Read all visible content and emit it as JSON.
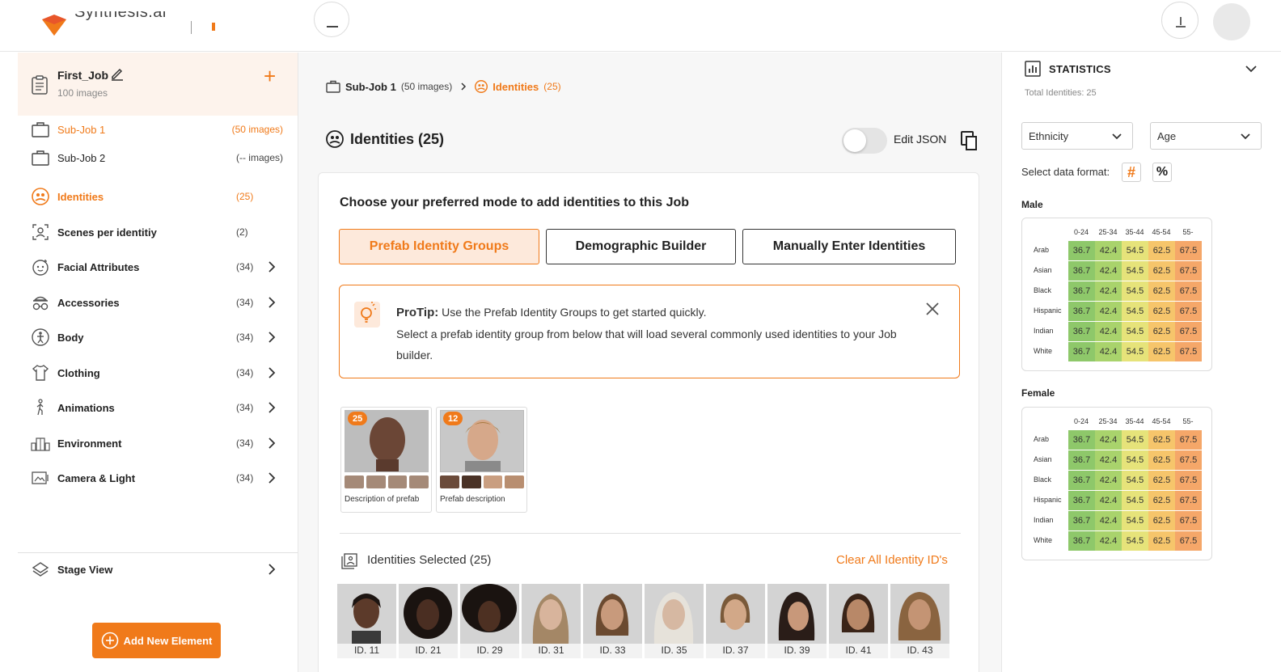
{
  "app": {
    "brand_text": "Synthesis.ai",
    "colors": {
      "accent": "#f07a1a",
      "accent_light": "#fde9db"
    }
  },
  "sidebar": {
    "job_title": "First_Job",
    "job_subtitle": "100 images",
    "items": [
      {
        "label": "Sub-Job 1",
        "count": "(50 images)",
        "icon": "briefcase-icon",
        "active": true
      },
      {
        "label": "Sub-Job 2",
        "count": "(-- images)",
        "icon": "briefcase-icon",
        "active": false
      },
      {
        "label": "Identities",
        "count": "(25)",
        "icon": "identities-icon",
        "active": true
      },
      {
        "label": "Scenes per identitiy",
        "count": "(2)",
        "icon": "scenes-icon",
        "active": false
      },
      {
        "label": "Facial Attributes",
        "count": "(34)",
        "icon": "face-icon",
        "active": false
      },
      {
        "label": "Accessories",
        "count": "(34)",
        "icon": "glasses-icon",
        "active": false
      },
      {
        "label": "Body",
        "count": "(34)",
        "icon": "body-icon",
        "active": false
      },
      {
        "label": "Clothing",
        "count": "(34)",
        "icon": "shirt-icon",
        "active": false
      },
      {
        "label": "Animations",
        "count": "(34)",
        "icon": "walking-icon",
        "active": false
      },
      {
        "label": "Environment",
        "count": "(34)",
        "icon": "buildings-icon",
        "active": false
      },
      {
        "label": "Camera & Light",
        "count": "(34)",
        "icon": "camera-icon",
        "active": false
      }
    ],
    "stage_view": "Stage View",
    "add_button": "Add New Element"
  },
  "main": {
    "breadcrumb": {
      "sub_job": "Sub-Job 1",
      "sub_job_count": "(50 images)",
      "current": "Identities",
      "current_count": "(25)"
    },
    "heading": "Identities (25)",
    "edit_json_label": "Edit JSON",
    "card_title": "Choose your preferred mode to add identities to this Job",
    "modes": [
      "Prefab Identity Groups",
      "Demographic Builder",
      "Manually Enter Identities"
    ],
    "protip": {
      "title": "ProTip:",
      "line1": "Use the Prefab Identity Groups to get started quickly.",
      "line2": "Select a prefab identity group from below that will load several commonly used identities to your Job builder."
    },
    "prefabs": [
      {
        "badge": "25",
        "description": "Description of prefab"
      },
      {
        "badge": "12",
        "description": "Prefab description"
      }
    ],
    "selected_title": "Identities Selected",
    "selected_count": "(25)",
    "clear_all": "Clear All Identity ID's",
    "identities": [
      "ID. 11",
      "ID. 21",
      "ID. 29",
      "ID. 31",
      "ID. 33",
      "ID. 35",
      "ID. 37",
      "ID. 39",
      "ID. 41",
      "ID. 43"
    ]
  },
  "stats": {
    "title": "STATISTICS",
    "total": "Total Identities: 25",
    "select_1": "Ethnicity",
    "select_2": "Age",
    "format_label": "Select data format:",
    "format_hash": "#",
    "format_pct": "%",
    "columns": [
      "0-24",
      "25-34",
      "35-44",
      "45-54",
      "55-"
    ],
    "cell_colors": [
      "#8ec86a",
      "#a9d36c",
      "#e6e37a",
      "#f6c56b",
      "#f5a769"
    ],
    "male": {
      "label": "Male",
      "rows": [
        {
          "name": "Arab",
          "values": [
            "36.7",
            "42.4",
            "54.5",
            "62.5",
            "67.5"
          ]
        },
        {
          "name": "Asian",
          "values": [
            "36.7",
            "42.4",
            "54.5",
            "62.5",
            "67.5"
          ]
        },
        {
          "name": "Black",
          "values": [
            "36.7",
            "42.4",
            "54.5",
            "62.5",
            "67.5"
          ]
        },
        {
          "name": "Hispanic",
          "values": [
            "36.7",
            "42.4",
            "54.5",
            "62.5",
            "67.5"
          ]
        },
        {
          "name": "Indian",
          "values": [
            "36.7",
            "42.4",
            "54.5",
            "62.5",
            "67.5"
          ]
        },
        {
          "name": "White",
          "values": [
            "36.7",
            "42.4",
            "54.5",
            "62.5",
            "67.5"
          ]
        }
      ]
    },
    "female": {
      "label": "Female",
      "rows": [
        {
          "name": "Arab",
          "values": [
            "36.7",
            "42.4",
            "54.5",
            "62.5",
            "67.5"
          ]
        },
        {
          "name": "Asian",
          "values": [
            "36.7",
            "42.4",
            "54.5",
            "62.5",
            "67.5"
          ]
        },
        {
          "name": "Black",
          "values": [
            "36.7",
            "42.4",
            "54.5",
            "62.5",
            "67.5"
          ]
        },
        {
          "name": "Hispanic",
          "values": [
            "36.7",
            "42.4",
            "54.5",
            "62.5",
            "67.5"
          ]
        },
        {
          "name": "Indian",
          "values": [
            "36.7",
            "42.4",
            "54.5",
            "62.5",
            "67.5"
          ]
        },
        {
          "name": "White",
          "values": [
            "36.7",
            "42.4",
            "54.5",
            "62.5",
            "67.5"
          ]
        }
      ]
    }
  }
}
